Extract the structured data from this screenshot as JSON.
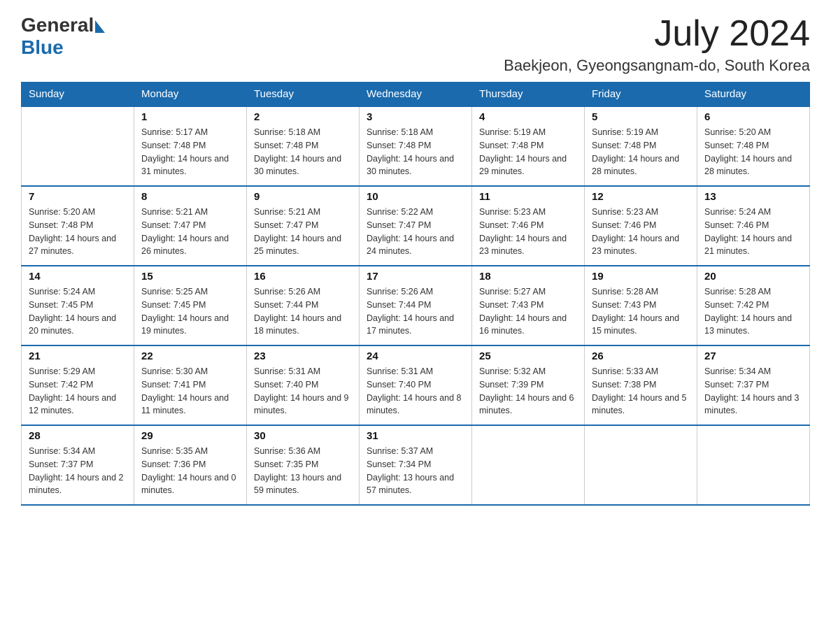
{
  "logo": {
    "general": "General",
    "blue": "Blue"
  },
  "header": {
    "month_year": "July 2024",
    "location": "Baekjeon, Gyeongsangnam-do, South Korea"
  },
  "days_of_week": [
    "Sunday",
    "Monday",
    "Tuesday",
    "Wednesday",
    "Thursday",
    "Friday",
    "Saturday"
  ],
  "weeks": [
    [
      {
        "day": "",
        "sunrise": "",
        "sunset": "",
        "daylight": ""
      },
      {
        "day": "1",
        "sunrise": "Sunrise: 5:17 AM",
        "sunset": "Sunset: 7:48 PM",
        "daylight": "Daylight: 14 hours and 31 minutes."
      },
      {
        "day": "2",
        "sunrise": "Sunrise: 5:18 AM",
        "sunset": "Sunset: 7:48 PM",
        "daylight": "Daylight: 14 hours and 30 minutes."
      },
      {
        "day": "3",
        "sunrise": "Sunrise: 5:18 AM",
        "sunset": "Sunset: 7:48 PM",
        "daylight": "Daylight: 14 hours and 30 minutes."
      },
      {
        "day": "4",
        "sunrise": "Sunrise: 5:19 AM",
        "sunset": "Sunset: 7:48 PM",
        "daylight": "Daylight: 14 hours and 29 minutes."
      },
      {
        "day": "5",
        "sunrise": "Sunrise: 5:19 AM",
        "sunset": "Sunset: 7:48 PM",
        "daylight": "Daylight: 14 hours and 28 minutes."
      },
      {
        "day": "6",
        "sunrise": "Sunrise: 5:20 AM",
        "sunset": "Sunset: 7:48 PM",
        "daylight": "Daylight: 14 hours and 28 minutes."
      }
    ],
    [
      {
        "day": "7",
        "sunrise": "Sunrise: 5:20 AM",
        "sunset": "Sunset: 7:48 PM",
        "daylight": "Daylight: 14 hours and 27 minutes."
      },
      {
        "day": "8",
        "sunrise": "Sunrise: 5:21 AM",
        "sunset": "Sunset: 7:47 PM",
        "daylight": "Daylight: 14 hours and 26 minutes."
      },
      {
        "day": "9",
        "sunrise": "Sunrise: 5:21 AM",
        "sunset": "Sunset: 7:47 PM",
        "daylight": "Daylight: 14 hours and 25 minutes."
      },
      {
        "day": "10",
        "sunrise": "Sunrise: 5:22 AM",
        "sunset": "Sunset: 7:47 PM",
        "daylight": "Daylight: 14 hours and 24 minutes."
      },
      {
        "day": "11",
        "sunrise": "Sunrise: 5:23 AM",
        "sunset": "Sunset: 7:46 PM",
        "daylight": "Daylight: 14 hours and 23 minutes."
      },
      {
        "day": "12",
        "sunrise": "Sunrise: 5:23 AM",
        "sunset": "Sunset: 7:46 PM",
        "daylight": "Daylight: 14 hours and 23 minutes."
      },
      {
        "day": "13",
        "sunrise": "Sunrise: 5:24 AM",
        "sunset": "Sunset: 7:46 PM",
        "daylight": "Daylight: 14 hours and 21 minutes."
      }
    ],
    [
      {
        "day": "14",
        "sunrise": "Sunrise: 5:24 AM",
        "sunset": "Sunset: 7:45 PM",
        "daylight": "Daylight: 14 hours and 20 minutes."
      },
      {
        "day": "15",
        "sunrise": "Sunrise: 5:25 AM",
        "sunset": "Sunset: 7:45 PM",
        "daylight": "Daylight: 14 hours and 19 minutes."
      },
      {
        "day": "16",
        "sunrise": "Sunrise: 5:26 AM",
        "sunset": "Sunset: 7:44 PM",
        "daylight": "Daylight: 14 hours and 18 minutes."
      },
      {
        "day": "17",
        "sunrise": "Sunrise: 5:26 AM",
        "sunset": "Sunset: 7:44 PM",
        "daylight": "Daylight: 14 hours and 17 minutes."
      },
      {
        "day": "18",
        "sunrise": "Sunrise: 5:27 AM",
        "sunset": "Sunset: 7:43 PM",
        "daylight": "Daylight: 14 hours and 16 minutes."
      },
      {
        "day": "19",
        "sunrise": "Sunrise: 5:28 AM",
        "sunset": "Sunset: 7:43 PM",
        "daylight": "Daylight: 14 hours and 15 minutes."
      },
      {
        "day": "20",
        "sunrise": "Sunrise: 5:28 AM",
        "sunset": "Sunset: 7:42 PM",
        "daylight": "Daylight: 14 hours and 13 minutes."
      }
    ],
    [
      {
        "day": "21",
        "sunrise": "Sunrise: 5:29 AM",
        "sunset": "Sunset: 7:42 PM",
        "daylight": "Daylight: 14 hours and 12 minutes."
      },
      {
        "day": "22",
        "sunrise": "Sunrise: 5:30 AM",
        "sunset": "Sunset: 7:41 PM",
        "daylight": "Daylight: 14 hours and 11 minutes."
      },
      {
        "day": "23",
        "sunrise": "Sunrise: 5:31 AM",
        "sunset": "Sunset: 7:40 PM",
        "daylight": "Daylight: 14 hours and 9 minutes."
      },
      {
        "day": "24",
        "sunrise": "Sunrise: 5:31 AM",
        "sunset": "Sunset: 7:40 PM",
        "daylight": "Daylight: 14 hours and 8 minutes."
      },
      {
        "day": "25",
        "sunrise": "Sunrise: 5:32 AM",
        "sunset": "Sunset: 7:39 PM",
        "daylight": "Daylight: 14 hours and 6 minutes."
      },
      {
        "day": "26",
        "sunrise": "Sunrise: 5:33 AM",
        "sunset": "Sunset: 7:38 PM",
        "daylight": "Daylight: 14 hours and 5 minutes."
      },
      {
        "day": "27",
        "sunrise": "Sunrise: 5:34 AM",
        "sunset": "Sunset: 7:37 PM",
        "daylight": "Daylight: 14 hours and 3 minutes."
      }
    ],
    [
      {
        "day": "28",
        "sunrise": "Sunrise: 5:34 AM",
        "sunset": "Sunset: 7:37 PM",
        "daylight": "Daylight: 14 hours and 2 minutes."
      },
      {
        "day": "29",
        "sunrise": "Sunrise: 5:35 AM",
        "sunset": "Sunset: 7:36 PM",
        "daylight": "Daylight: 14 hours and 0 minutes."
      },
      {
        "day": "30",
        "sunrise": "Sunrise: 5:36 AM",
        "sunset": "Sunset: 7:35 PM",
        "daylight": "Daylight: 13 hours and 59 minutes."
      },
      {
        "day": "31",
        "sunrise": "Sunrise: 5:37 AM",
        "sunset": "Sunset: 7:34 PM",
        "daylight": "Daylight: 13 hours and 57 minutes."
      },
      {
        "day": "",
        "sunrise": "",
        "sunset": "",
        "daylight": ""
      },
      {
        "day": "",
        "sunrise": "",
        "sunset": "",
        "daylight": ""
      },
      {
        "day": "",
        "sunrise": "",
        "sunset": "",
        "daylight": ""
      }
    ]
  ]
}
